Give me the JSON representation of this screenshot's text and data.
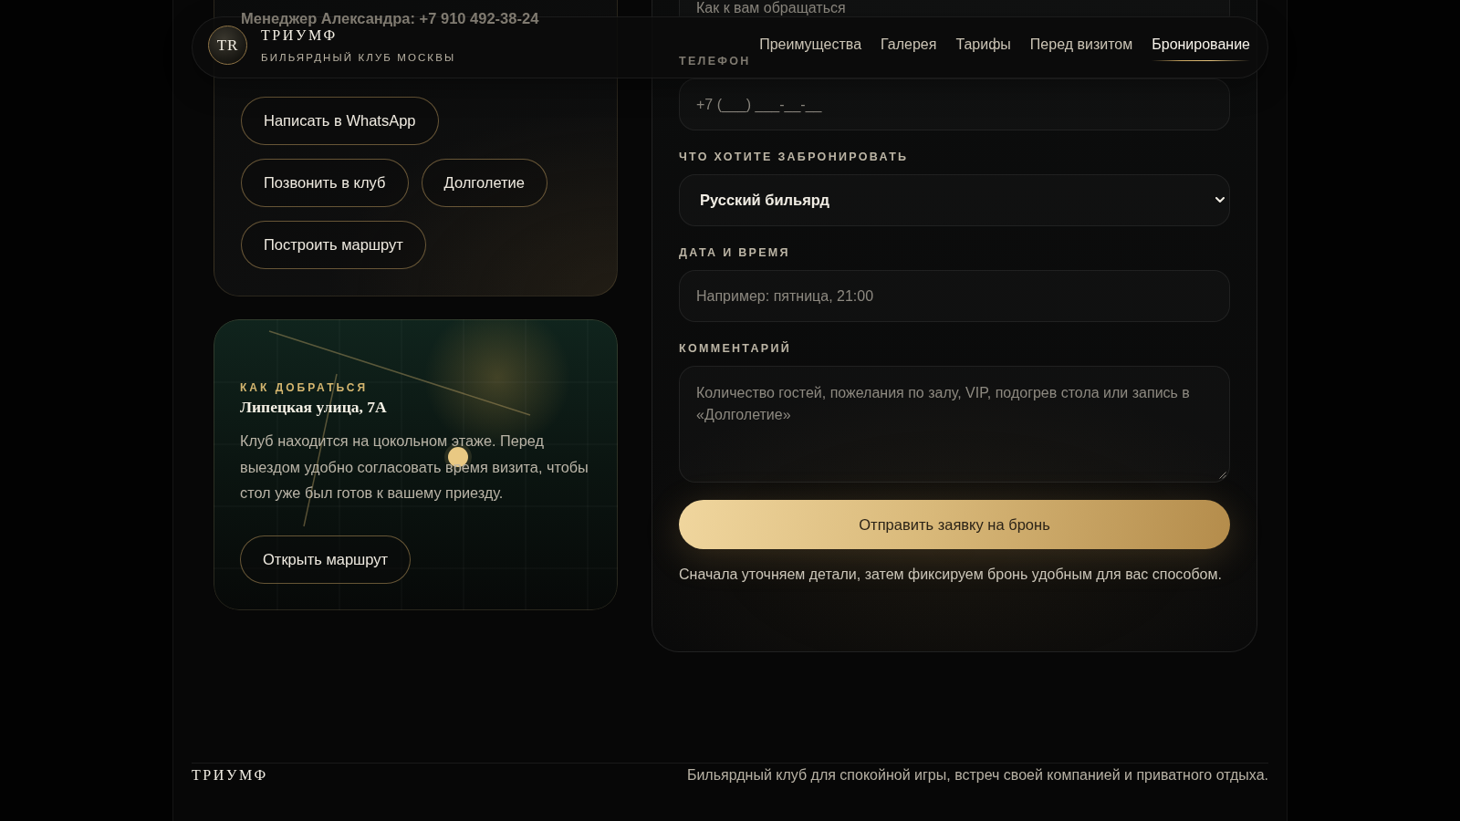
{
  "header": {
    "logo": {
      "monogram": "TR"
    },
    "brand": "ТРИУМФ",
    "tagline": "БИЛЬЯРДНЫЙ КЛУБ МОСКВЫ",
    "nav": [
      {
        "label": "Преимущества",
        "selected": false
      },
      {
        "label": "Галерея",
        "selected": false
      },
      {
        "label": "Тарифы",
        "selected": false
      },
      {
        "label": "Перед визитом",
        "selected": false
      },
      {
        "label": "Бронирование",
        "selected": true
      }
    ]
  },
  "contacts_card": {
    "manager": "Менеджер Александра: +7 910 492-38-24",
    "buttons": [
      "Написать в WhatsApp",
      "Позвонить в клуб",
      "Долголетие",
      "Построить маршрут"
    ]
  },
  "location_card": {
    "eyebrow": "КАК ДОБРАТЬСЯ",
    "address": "Липецкая улица, 7А",
    "description": "Клуб находится на цокольном этаже. Перед выездом удобно согласовать время визита, чтобы стол уже был готов к вашему приезду.",
    "button": "Открыть маршрут"
  },
  "booking_form": {
    "fields": [
      {
        "kind": "input",
        "placeholder": "Как к вам обращаться"
      },
      {
        "kind": "input",
        "label": "ТЕЛЕФОН",
        "placeholder": "+7 (___) ___-__-__"
      },
      {
        "kind": "select",
        "label": "ЧТО ХОТИТЕ ЗАБРОНИРОВАТЬ",
        "value": "Русский бильярд"
      },
      {
        "kind": "input",
        "label": "ДАТА И ВРЕМЯ",
        "placeholder": "Например: пятница, 21:00"
      },
      {
        "kind": "textarea",
        "label": "КОММЕНТАРИЙ",
        "placeholder": "Количество гостей, пожелания по залу, VIP, подогрев стола или запись в «Долголетие»"
      }
    ],
    "submit": "Отправить заявку на бронь",
    "note": "Сначала уточняем детали, затем фиксируем бронь удобным для вас способом."
  },
  "footer": {
    "brand": "ТРИУМФ",
    "tagline": "Бильярдный клуб для спокойной игры, встреч своей компанией и приватного отдыха."
  }
}
